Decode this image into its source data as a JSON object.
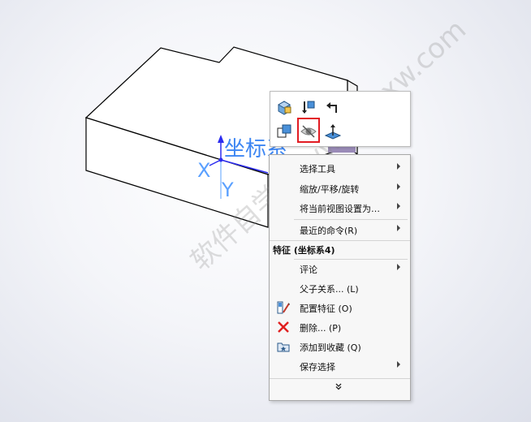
{
  "model_view": {
    "coordinate_label": "坐标系",
    "axis_x": "X",
    "axis_y": "Y",
    "watermark": "软件自学网 www.rjzxw.com"
  },
  "toolbar": {
    "buttons": [
      {
        "name": "appearance-icon",
        "row": 1
      },
      {
        "name": "normal-to-icon",
        "row": 1
      },
      {
        "name": "go-back-icon",
        "row": 1
      },
      {
        "name": "copy-view-icon",
        "row": 2
      },
      {
        "name": "hide-show-eye-icon",
        "row": 2,
        "highlighted": true
      },
      {
        "name": "plane-normal-icon",
        "row": 2
      }
    ],
    "highlight_color": "#e21b22"
  },
  "menu": {
    "select_tools": "选择工具",
    "zoom_pan_rotate": "缩放/平移/旋转",
    "set_current_view": "将当前视图设置为…",
    "recent_commands": "最近的命令(R)",
    "feature_header": "特征 (坐标系4)",
    "comment": "评论",
    "parent_child": "父子关系... (L)",
    "config_feature": "配置特征 (O)",
    "delete": "删除... (P)",
    "add_to_favorites": "添加到收藏 (Q)",
    "save_selection": "保存选择",
    "more": "more-chevron-icon"
  }
}
